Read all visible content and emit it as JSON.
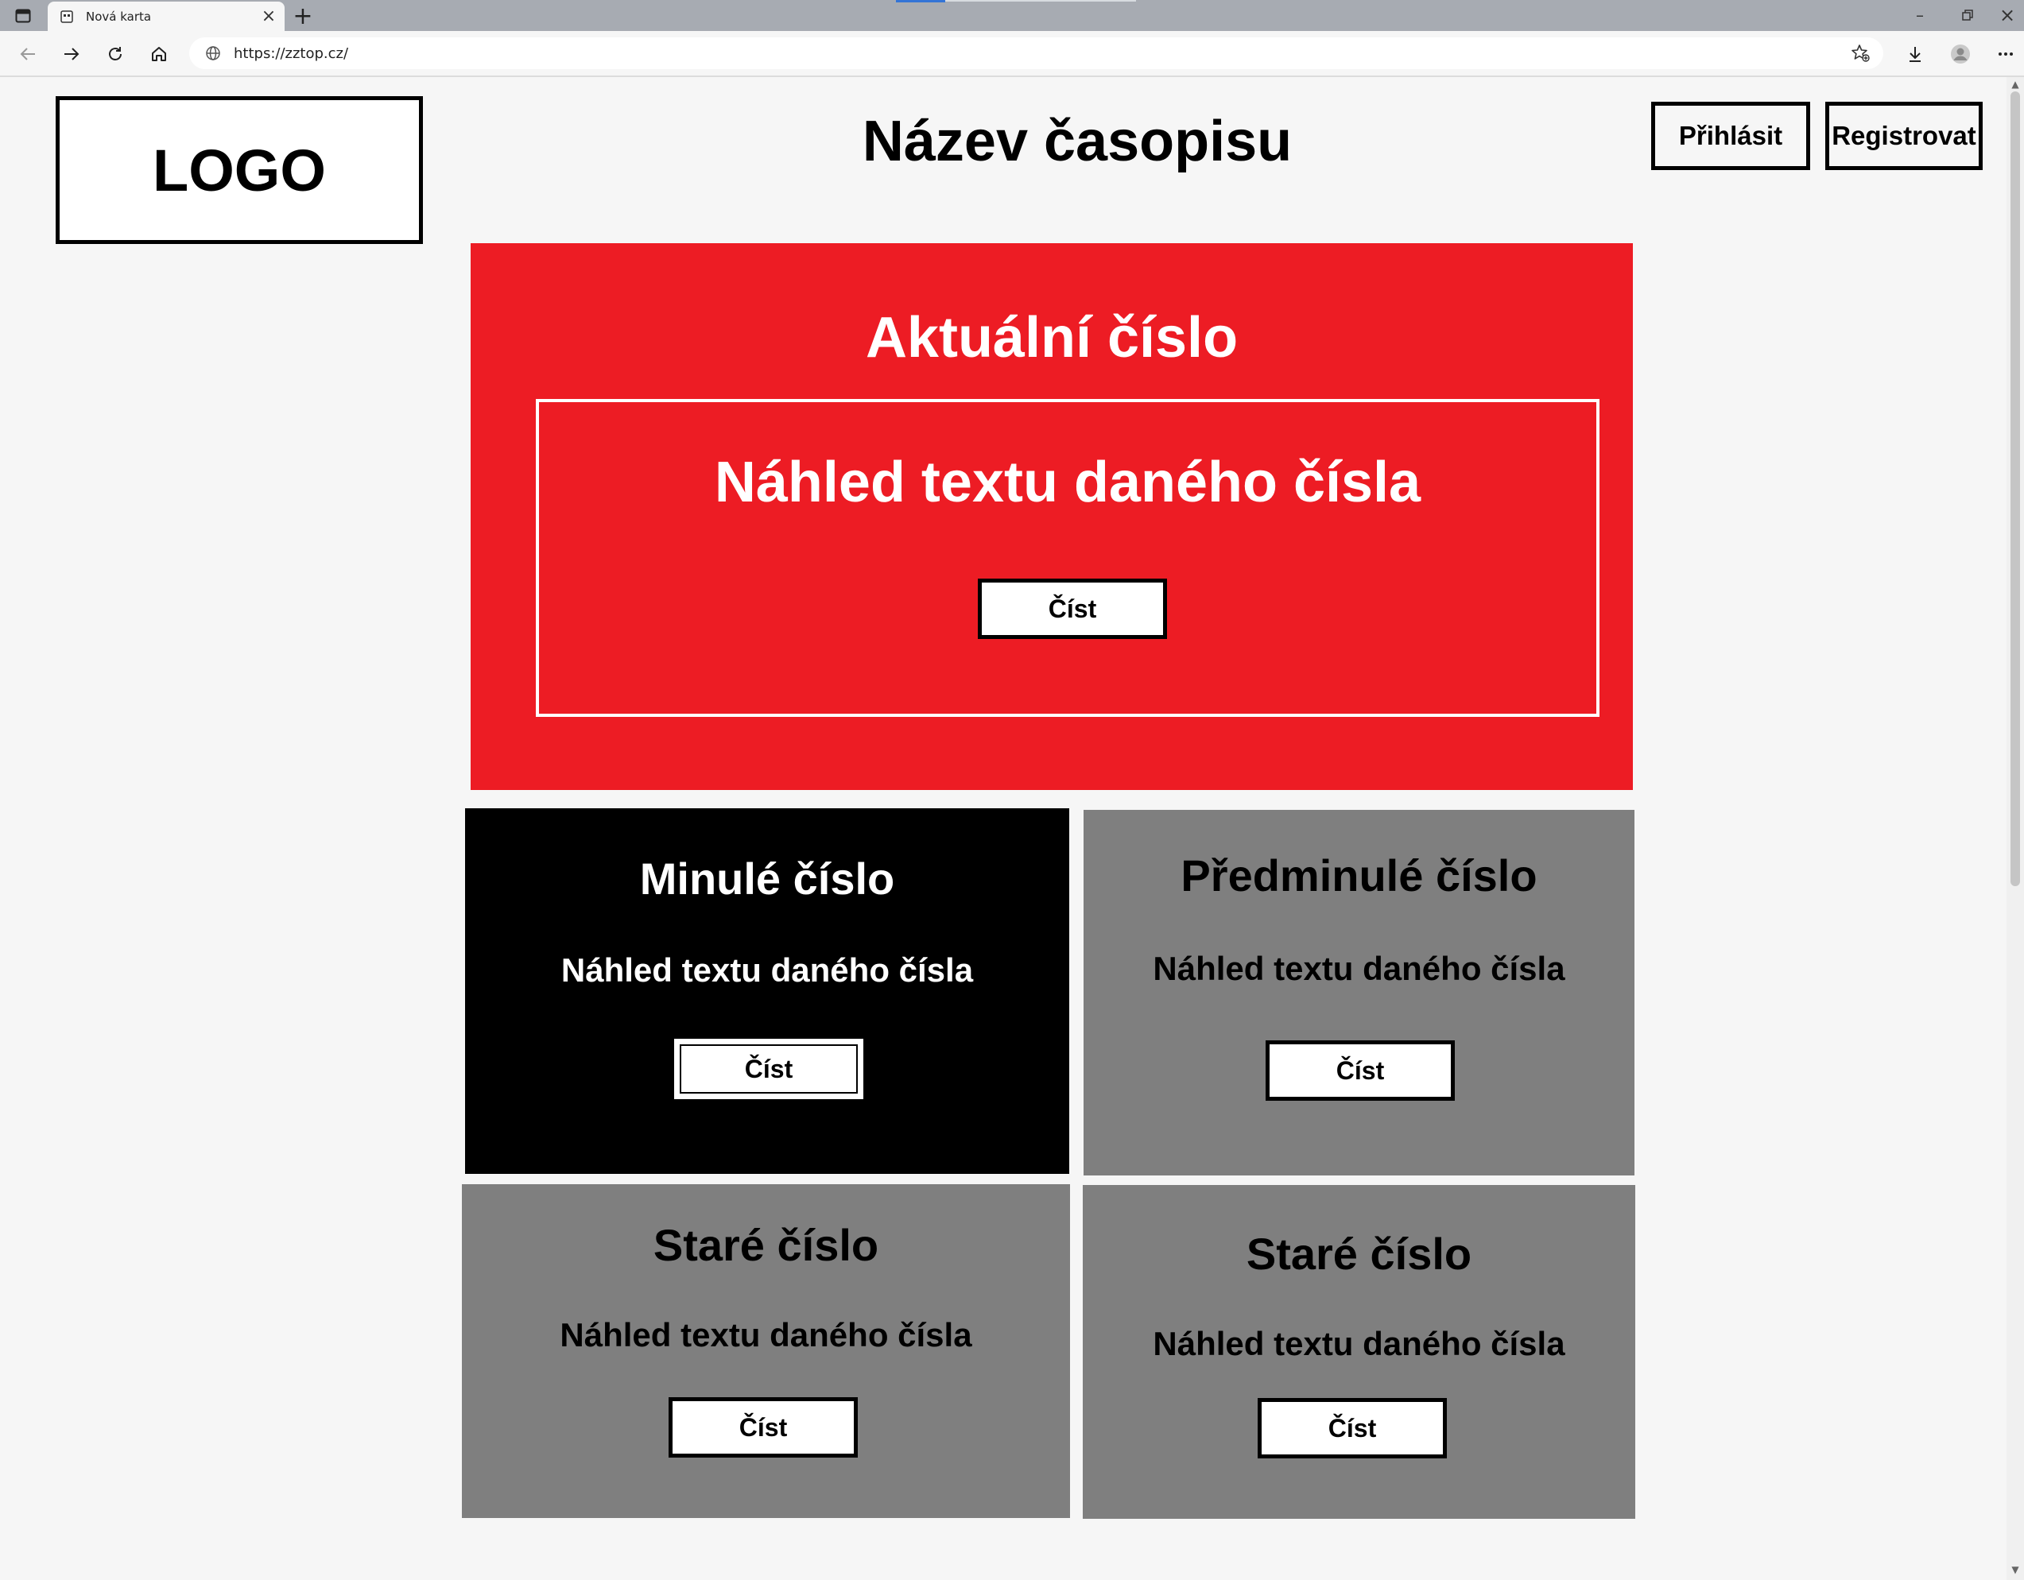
{
  "browser": {
    "tab_title": "Nová karta",
    "url": "https://zztop.cz/"
  },
  "header": {
    "logo": "LOGO",
    "title": "Název časopisu",
    "login_label": "Přihlásit",
    "register_label": "Registrovat"
  },
  "current_issue": {
    "title": "Aktuální číslo",
    "preview": "Náhled textu daného čísla",
    "read_label": "Číst"
  },
  "issues": [
    {
      "title": "Minulé číslo",
      "preview": "Náhled textu daného čísla",
      "read_label": "Číst"
    },
    {
      "title": "Předminulé číslo",
      "preview": "Náhled textu daného čísla",
      "read_label": "Číst"
    },
    {
      "title": "Staré číslo",
      "preview": "Náhled textu daného čísla",
      "read_label": "Číst"
    },
    {
      "title": "Staré číslo",
      "preview": "Náhled textu daného čísla",
      "read_label": "Číst"
    }
  ],
  "colors": {
    "hero": "#ed1c24",
    "past_issue": "#000000",
    "older_issue": "#7f7f7f"
  }
}
